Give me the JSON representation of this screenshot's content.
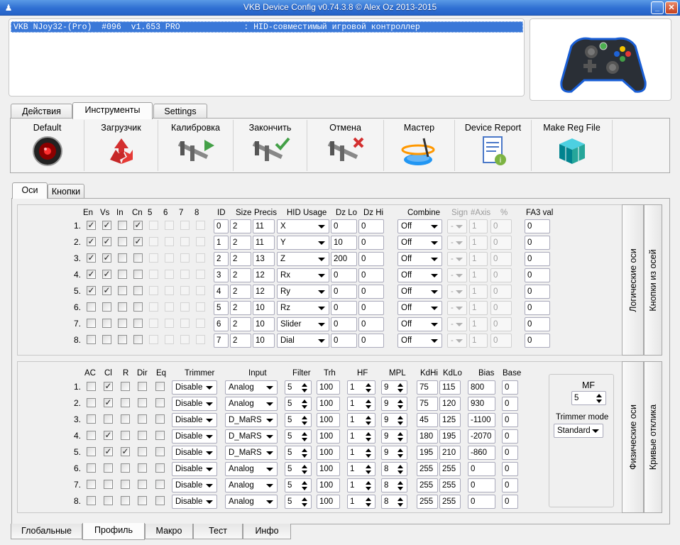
{
  "window": {
    "title": "VKB Device Config v0.74.3.8 © Alex Oz 2013-2015"
  },
  "device_list": {
    "selected": "VKB NJoy32-(Pro)  #096  v1.653 PRO             : HID-совместимый игровой контроллер"
  },
  "main_tabs": [
    {
      "label": "Действия"
    },
    {
      "label": "Инструменты"
    },
    {
      "label": "Settings"
    }
  ],
  "toolbar": [
    {
      "label": "Default",
      "icon": "hal-eye-icon"
    },
    {
      "label": "Загрузчик",
      "icon": "recycle-icon"
    },
    {
      "label": "Калибровка",
      "icon": "caliper-play-icon"
    },
    {
      "label": "Закончить",
      "icon": "caliper-check-icon"
    },
    {
      "label": "Отмена",
      "icon": "caliper-cancel-icon"
    },
    {
      "label": "Мастер",
      "icon": "wizard-icon"
    },
    {
      "label": "Device Report",
      "icon": "report-icon"
    },
    {
      "label": "Make Reg File",
      "icon": "registry-icon"
    }
  ],
  "sub_tabs": [
    {
      "label": "Оси"
    },
    {
      "label": "Кнопки"
    }
  ],
  "logical": {
    "headers": {
      "en": "En",
      "vs": "Vs",
      "in": "In",
      "cn": "Cn",
      "c5": "5",
      "c6": "6",
      "c7": "7",
      "c8": "8",
      "id": "ID",
      "size": "Size",
      "precis": "Precis",
      "hid": "HID Usage",
      "dzlo": "Dz Lo",
      "dzhi": "Dz Hi",
      "combine": "Combine",
      "sign": "Sign",
      "naxis": "#Axis",
      "pct": "%",
      "fa3": "FA3 val"
    },
    "rows": [
      {
        "num": "1.",
        "en": true,
        "vs": true,
        "in": false,
        "cn": true,
        "id": "0",
        "size": "2",
        "precis": "11",
        "usage": "X",
        "dzlo": "0",
        "dzhi": "0",
        "combine": "Off",
        "sign": "-",
        "naxis": "1",
        "pct": "0",
        "fa3": "0"
      },
      {
        "num": "2.",
        "en": true,
        "vs": true,
        "in": false,
        "cn": true,
        "id": "1",
        "size": "2",
        "precis": "11",
        "usage": "Y",
        "dzlo": "10",
        "dzhi": "0",
        "combine": "Off",
        "sign": "-",
        "naxis": "1",
        "pct": "0",
        "fa3": "0"
      },
      {
        "num": "3.",
        "en": true,
        "vs": true,
        "in": false,
        "cn": false,
        "id": "2",
        "size": "2",
        "precis": "13",
        "usage": "Z",
        "dzlo": "200",
        "dzhi": "0",
        "combine": "Off",
        "sign": "-",
        "naxis": "1",
        "pct": "0",
        "fa3": "0"
      },
      {
        "num": "4.",
        "en": true,
        "vs": true,
        "in": false,
        "cn": false,
        "id": "3",
        "size": "2",
        "precis": "12",
        "usage": "Rx",
        "dzlo": "0",
        "dzhi": "0",
        "combine": "Off",
        "sign": "-",
        "naxis": "1",
        "pct": "0",
        "fa3": "0"
      },
      {
        "num": "5.",
        "en": true,
        "vs": true,
        "in": false,
        "cn": false,
        "id": "4",
        "size": "2",
        "precis": "12",
        "usage": "Ry",
        "dzlo": "0",
        "dzhi": "0",
        "combine": "Off",
        "sign": "-",
        "naxis": "1",
        "pct": "0",
        "fa3": "0"
      },
      {
        "num": "6.",
        "en": false,
        "vs": false,
        "in": false,
        "cn": false,
        "id": "5",
        "size": "2",
        "precis": "10",
        "usage": "Rz",
        "dzlo": "0",
        "dzhi": "0",
        "combine": "Off",
        "sign": "-",
        "naxis": "1",
        "pct": "0",
        "fa3": "0"
      },
      {
        "num": "7.",
        "en": false,
        "vs": false,
        "in": false,
        "cn": false,
        "id": "6",
        "size": "2",
        "precis": "10",
        "usage": "Slider",
        "dzlo": "0",
        "dzhi": "0",
        "combine": "Off",
        "sign": "-",
        "naxis": "1",
        "pct": "0",
        "fa3": "0"
      },
      {
        "num": "8.",
        "en": false,
        "vs": false,
        "in": false,
        "cn": false,
        "id": "7",
        "size": "2",
        "precis": "10",
        "usage": "Dial",
        "dzlo": "0",
        "dzhi": "0",
        "combine": "Off",
        "sign": "-",
        "naxis": "1",
        "pct": "0",
        "fa3": "0"
      }
    ]
  },
  "physical": {
    "headers": {
      "ac": "AC",
      "cl": "Cl",
      "r": "R",
      "dir": "Dir",
      "eq": "Eq",
      "trimmer": "Trimmer",
      "input": "Input",
      "filter": "Filter",
      "trh": "Trh",
      "hf": "HF",
      "mpl": "MPL",
      "kdhi": "KdHi",
      "kdlo": "KdLo",
      "bias": "Bias",
      "base": "Base"
    },
    "rows": [
      {
        "num": "1.",
        "ac": false,
        "cl": true,
        "r": false,
        "trimmer": "Disable",
        "input": "Analog",
        "filter": "5",
        "trh": "100",
        "hf": "1",
        "mpl": "9",
        "kdhi": "75",
        "kdlo": "115",
        "bias": "800",
        "base": "0"
      },
      {
        "num": "2.",
        "ac": false,
        "cl": true,
        "r": false,
        "trimmer": "Disable",
        "input": "Analog",
        "filter": "5",
        "trh": "100",
        "hf": "1",
        "mpl": "9",
        "kdhi": "75",
        "kdlo": "120",
        "bias": "930",
        "base": "0"
      },
      {
        "num": "3.",
        "ac": false,
        "cl": false,
        "r": false,
        "trimmer": "Disable",
        "input": "D_MaRS",
        "filter": "5",
        "trh": "100",
        "hf": "1",
        "mpl": "9",
        "kdhi": "45",
        "kdlo": "125",
        "bias": "-1100",
        "base": "0"
      },
      {
        "num": "4.",
        "ac": false,
        "cl": true,
        "r": false,
        "trimmer": "Disable",
        "input": "D_MaRS",
        "filter": "5",
        "trh": "100",
        "hf": "1",
        "mpl": "9",
        "kdhi": "180",
        "kdlo": "195",
        "bias": "-2070",
        "base": "0"
      },
      {
        "num": "5.",
        "ac": false,
        "cl": true,
        "r": true,
        "trimmer": "Disable",
        "input": "D_MaRS",
        "filter": "5",
        "trh": "100",
        "hf": "1",
        "mpl": "9",
        "kdhi": "195",
        "kdlo": "210",
        "bias": "-860",
        "base": "0"
      },
      {
        "num": "6.",
        "ac": false,
        "cl": false,
        "r": false,
        "trimmer": "Disable",
        "input": "Analog",
        "filter": "5",
        "trh": "100",
        "hf": "1",
        "mpl": "8",
        "kdhi": "255",
        "kdlo": "255",
        "bias": "0",
        "base": "0"
      },
      {
        "num": "7.",
        "ac": false,
        "cl": false,
        "r": false,
        "trimmer": "Disable",
        "input": "Analog",
        "filter": "5",
        "trh": "100",
        "hf": "1",
        "mpl": "8",
        "kdhi": "255",
        "kdlo": "255",
        "bias": "0",
        "base": "0"
      },
      {
        "num": "8.",
        "ac": false,
        "cl": false,
        "r": false,
        "trimmer": "Disable",
        "input": "Analog",
        "filter": "5",
        "trh": "100",
        "hf": "1",
        "mpl": "8",
        "kdhi": "255",
        "kdlo": "255",
        "bias": "0",
        "base": "0"
      }
    ],
    "mf": {
      "label": "MF",
      "value": "5",
      "trimmer_mode_label": "Trimmer mode",
      "trimmer_mode": "Standard"
    }
  },
  "side_tabs": {
    "logical": "Логические оси",
    "buttons_from_axes": "Кнопки из осей",
    "physical": "Физические оси",
    "curves": "Кривые отклика"
  },
  "bottom_tabs": [
    {
      "label": "Глобальные"
    },
    {
      "label": "Профиль"
    },
    {
      "label": "Макро"
    },
    {
      "label": "Тест"
    },
    {
      "label": "Инфо"
    }
  ],
  "colors": {
    "titlebar": "#2f6fd2",
    "selection": "#3a78d8"
  }
}
